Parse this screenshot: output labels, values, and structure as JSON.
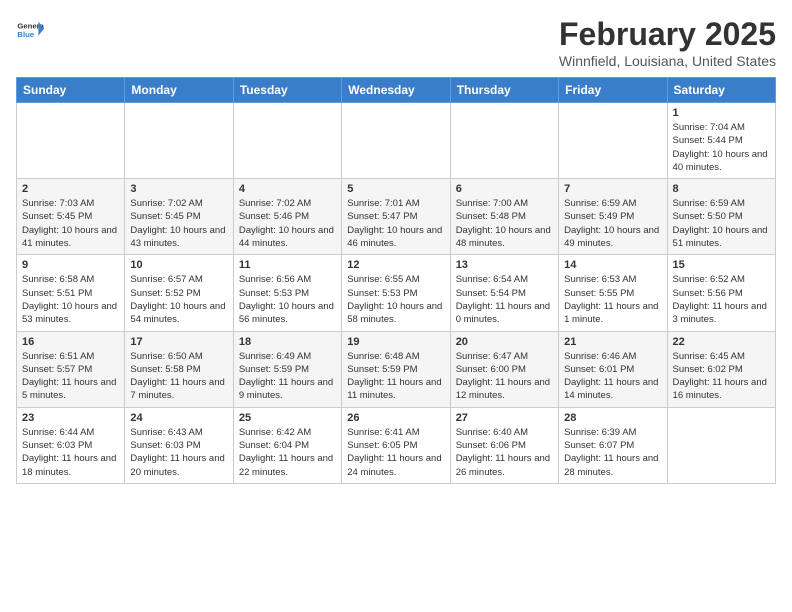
{
  "header": {
    "logo_general": "General",
    "logo_blue": "Blue",
    "month_title": "February 2025",
    "subtitle": "Winnfield, Louisiana, United States"
  },
  "weekdays": [
    "Sunday",
    "Monday",
    "Tuesday",
    "Wednesday",
    "Thursday",
    "Friday",
    "Saturday"
  ],
  "weeks": [
    [
      {
        "day": "",
        "info": ""
      },
      {
        "day": "",
        "info": ""
      },
      {
        "day": "",
        "info": ""
      },
      {
        "day": "",
        "info": ""
      },
      {
        "day": "",
        "info": ""
      },
      {
        "day": "",
        "info": ""
      },
      {
        "day": "1",
        "info": "Sunrise: 7:04 AM\nSunset: 5:44 PM\nDaylight: 10 hours and 40 minutes."
      }
    ],
    [
      {
        "day": "2",
        "info": "Sunrise: 7:03 AM\nSunset: 5:45 PM\nDaylight: 10 hours and 41 minutes."
      },
      {
        "day": "3",
        "info": "Sunrise: 7:02 AM\nSunset: 5:45 PM\nDaylight: 10 hours and 43 minutes."
      },
      {
        "day": "4",
        "info": "Sunrise: 7:02 AM\nSunset: 5:46 PM\nDaylight: 10 hours and 44 minutes."
      },
      {
        "day": "5",
        "info": "Sunrise: 7:01 AM\nSunset: 5:47 PM\nDaylight: 10 hours and 46 minutes."
      },
      {
        "day": "6",
        "info": "Sunrise: 7:00 AM\nSunset: 5:48 PM\nDaylight: 10 hours and 48 minutes."
      },
      {
        "day": "7",
        "info": "Sunrise: 6:59 AM\nSunset: 5:49 PM\nDaylight: 10 hours and 49 minutes."
      },
      {
        "day": "8",
        "info": "Sunrise: 6:59 AM\nSunset: 5:50 PM\nDaylight: 10 hours and 51 minutes."
      }
    ],
    [
      {
        "day": "9",
        "info": "Sunrise: 6:58 AM\nSunset: 5:51 PM\nDaylight: 10 hours and 53 minutes."
      },
      {
        "day": "10",
        "info": "Sunrise: 6:57 AM\nSunset: 5:52 PM\nDaylight: 10 hours and 54 minutes."
      },
      {
        "day": "11",
        "info": "Sunrise: 6:56 AM\nSunset: 5:53 PM\nDaylight: 10 hours and 56 minutes."
      },
      {
        "day": "12",
        "info": "Sunrise: 6:55 AM\nSunset: 5:53 PM\nDaylight: 10 hours and 58 minutes."
      },
      {
        "day": "13",
        "info": "Sunrise: 6:54 AM\nSunset: 5:54 PM\nDaylight: 11 hours and 0 minutes."
      },
      {
        "day": "14",
        "info": "Sunrise: 6:53 AM\nSunset: 5:55 PM\nDaylight: 11 hours and 1 minute."
      },
      {
        "day": "15",
        "info": "Sunrise: 6:52 AM\nSunset: 5:56 PM\nDaylight: 11 hours and 3 minutes."
      }
    ],
    [
      {
        "day": "16",
        "info": "Sunrise: 6:51 AM\nSunset: 5:57 PM\nDaylight: 11 hours and 5 minutes."
      },
      {
        "day": "17",
        "info": "Sunrise: 6:50 AM\nSunset: 5:58 PM\nDaylight: 11 hours and 7 minutes."
      },
      {
        "day": "18",
        "info": "Sunrise: 6:49 AM\nSunset: 5:59 PM\nDaylight: 11 hours and 9 minutes."
      },
      {
        "day": "19",
        "info": "Sunrise: 6:48 AM\nSunset: 5:59 PM\nDaylight: 11 hours and 11 minutes."
      },
      {
        "day": "20",
        "info": "Sunrise: 6:47 AM\nSunset: 6:00 PM\nDaylight: 11 hours and 12 minutes."
      },
      {
        "day": "21",
        "info": "Sunrise: 6:46 AM\nSunset: 6:01 PM\nDaylight: 11 hours and 14 minutes."
      },
      {
        "day": "22",
        "info": "Sunrise: 6:45 AM\nSunset: 6:02 PM\nDaylight: 11 hours and 16 minutes."
      }
    ],
    [
      {
        "day": "23",
        "info": "Sunrise: 6:44 AM\nSunset: 6:03 PM\nDaylight: 11 hours and 18 minutes."
      },
      {
        "day": "24",
        "info": "Sunrise: 6:43 AM\nSunset: 6:03 PM\nDaylight: 11 hours and 20 minutes."
      },
      {
        "day": "25",
        "info": "Sunrise: 6:42 AM\nSunset: 6:04 PM\nDaylight: 11 hours and 22 minutes."
      },
      {
        "day": "26",
        "info": "Sunrise: 6:41 AM\nSunset: 6:05 PM\nDaylight: 11 hours and 24 minutes."
      },
      {
        "day": "27",
        "info": "Sunrise: 6:40 AM\nSunset: 6:06 PM\nDaylight: 11 hours and 26 minutes."
      },
      {
        "day": "28",
        "info": "Sunrise: 6:39 AM\nSunset: 6:07 PM\nDaylight: 11 hours and 28 minutes."
      },
      {
        "day": "",
        "info": ""
      }
    ]
  ]
}
